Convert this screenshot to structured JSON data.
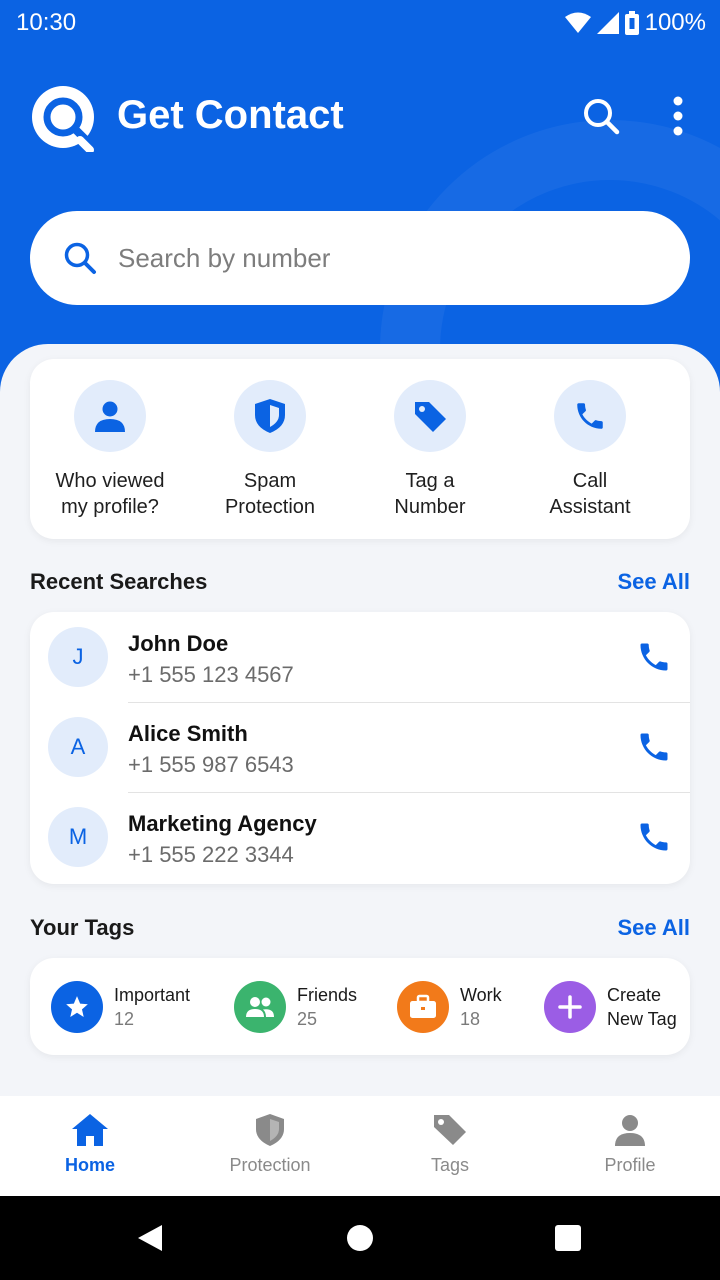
{
  "status_bar": {
    "time": "10:30",
    "battery": "100%"
  },
  "header": {
    "title": "Get Contact"
  },
  "search": {
    "placeholder": "Search by number"
  },
  "features": [
    {
      "label": "Who viewed\nmy profile?",
      "icon": "person-icon"
    },
    {
      "label": "Spam\nProtection",
      "icon": "shield-icon"
    },
    {
      "label": "Tag a\nNumber",
      "icon": "tag-icon"
    },
    {
      "label": "Call\nAssistant",
      "icon": "phone-icon"
    }
  ],
  "recent": {
    "title": "Recent Searches",
    "see_all": "See All",
    "items": [
      {
        "initial": "J",
        "name": "John Doe",
        "phone": "+1 555 123 4567"
      },
      {
        "initial": "A",
        "name": "Alice Smith",
        "phone": "+1 555 987 6543"
      },
      {
        "initial": "M",
        "name": "Marketing Agency",
        "phone": "+1 555 222 3344"
      }
    ]
  },
  "tags": {
    "title": "Your Tags",
    "see_all": "See All",
    "items": [
      {
        "name": "Important",
        "count": "12",
        "color": "#0b63e3",
        "icon": "star-icon"
      },
      {
        "name": "Friends",
        "count": "25",
        "color": "#3bb46e",
        "icon": "people-icon"
      },
      {
        "name": "Work",
        "count": "18",
        "color": "#f27a1a",
        "icon": "briefcase-icon"
      },
      {
        "name": "Create",
        "count": "New Tag",
        "color": "#9b5de5",
        "icon": "plus-icon"
      }
    ]
  },
  "nav": [
    {
      "label": "Home",
      "icon": "home-icon",
      "active": true
    },
    {
      "label": "Protection",
      "icon": "shield-icon",
      "active": false
    },
    {
      "label": "Tags",
      "icon": "tag-icon",
      "active": false
    },
    {
      "label": "Profile",
      "icon": "person-icon",
      "active": false
    }
  ],
  "colors": {
    "primary": "#0b63e3",
    "background": "#f3f5f9",
    "icon_bg": "#e2ecfb"
  }
}
